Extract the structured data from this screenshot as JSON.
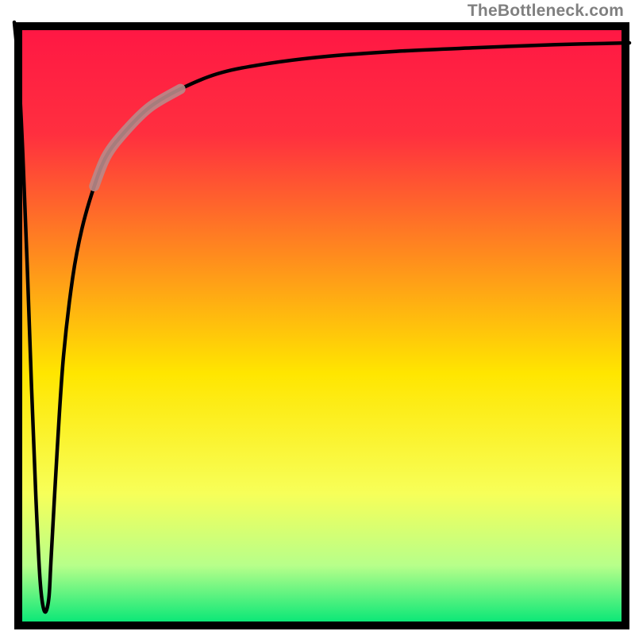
{
  "attribution": "TheBottleneck.com",
  "chart_data": {
    "type": "line",
    "title": "",
    "xlabel": "",
    "ylabel": "",
    "xlim": [
      0,
      100
    ],
    "ylim": [
      0,
      100
    ],
    "grid": false,
    "legend": false,
    "series": [
      {
        "name": "bottleneck-curve",
        "x": [
          0.0,
          0.7,
          1.4,
          2.1,
          2.8,
          3.5,
          4.2,
          4.9,
          5.6,
          6.0,
          7.0,
          8.0,
          9.5,
          11.0,
          13.0,
          15.0,
          18.0,
          22.0,
          27.0,
          33.0,
          40.0,
          50.0,
          62.0,
          75.0,
          88.0,
          100.0
        ],
        "y": [
          100.0,
          92.0,
          78.0,
          60.0,
          40.0,
          22.0,
          8.0,
          3.0,
          5.0,
          12.0,
          30.0,
          45.0,
          58.0,
          66.0,
          73.0,
          78.0,
          82.0,
          86.0,
          89.0,
          91.5,
          93.0,
          94.3,
          95.2,
          95.8,
          96.3,
          96.6
        ]
      }
    ],
    "highlight_segment": {
      "series": "bottleneck-curve",
      "x_start": 15.0,
      "x_end": 22.0
    },
    "background_gradient_stops": [
      {
        "offset": 0.0,
        "color": "#ff1744"
      },
      {
        "offset": 0.18,
        "color": "#ff2f3f"
      },
      {
        "offset": 0.38,
        "color": "#ff8a1e"
      },
      {
        "offset": 0.58,
        "color": "#ffe600"
      },
      {
        "offset": 0.78,
        "color": "#f7ff59"
      },
      {
        "offset": 0.9,
        "color": "#b7ff8a"
      },
      {
        "offset": 1.0,
        "color": "#00e676"
      }
    ],
    "frame_color": "#000000",
    "curve_color": "#000000",
    "highlight_color": "#b98a8a"
  }
}
